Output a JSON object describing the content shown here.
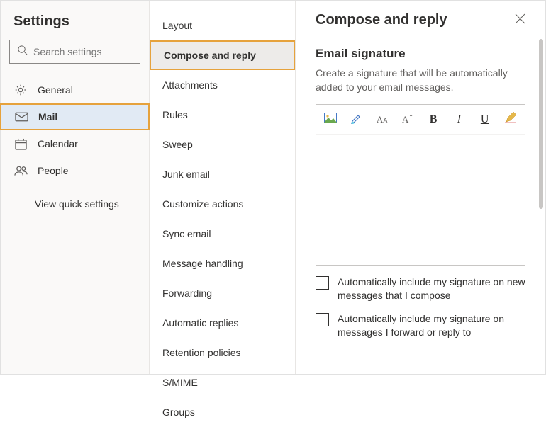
{
  "sidebar": {
    "title": "Settings",
    "search_placeholder": "Search settings",
    "items": [
      {
        "icon": "gear",
        "label": "General"
      },
      {
        "icon": "mail",
        "label": "Mail"
      },
      {
        "icon": "calendar",
        "label": "Calendar"
      },
      {
        "icon": "people",
        "label": "People"
      }
    ],
    "quick_link": "View quick settings"
  },
  "menu": {
    "items": [
      "Layout",
      "Compose and reply",
      "Attachments",
      "Rules",
      "Sweep",
      "Junk email",
      "Customize actions",
      "Sync email",
      "Message handling",
      "Forwarding",
      "Automatic replies",
      "Retention policies",
      "S/MIME",
      "Groups"
    ]
  },
  "content": {
    "title": "Compose and reply",
    "section_title": "Email signature",
    "section_desc": "Create a signature that will be automatically added to your email messages.",
    "toolbar": {
      "image": "image-icon",
      "highlight": "highlight-icon",
      "fontsize": "AA",
      "fontsize_sub": "A",
      "bold": "B",
      "italic": "I",
      "underline": "U",
      "pencil": "pencil-icon"
    },
    "checkbox1": "Automatically include my signature on new messages that I compose",
    "checkbox2": "Automatically include my signature on messages I forward or reply to"
  }
}
